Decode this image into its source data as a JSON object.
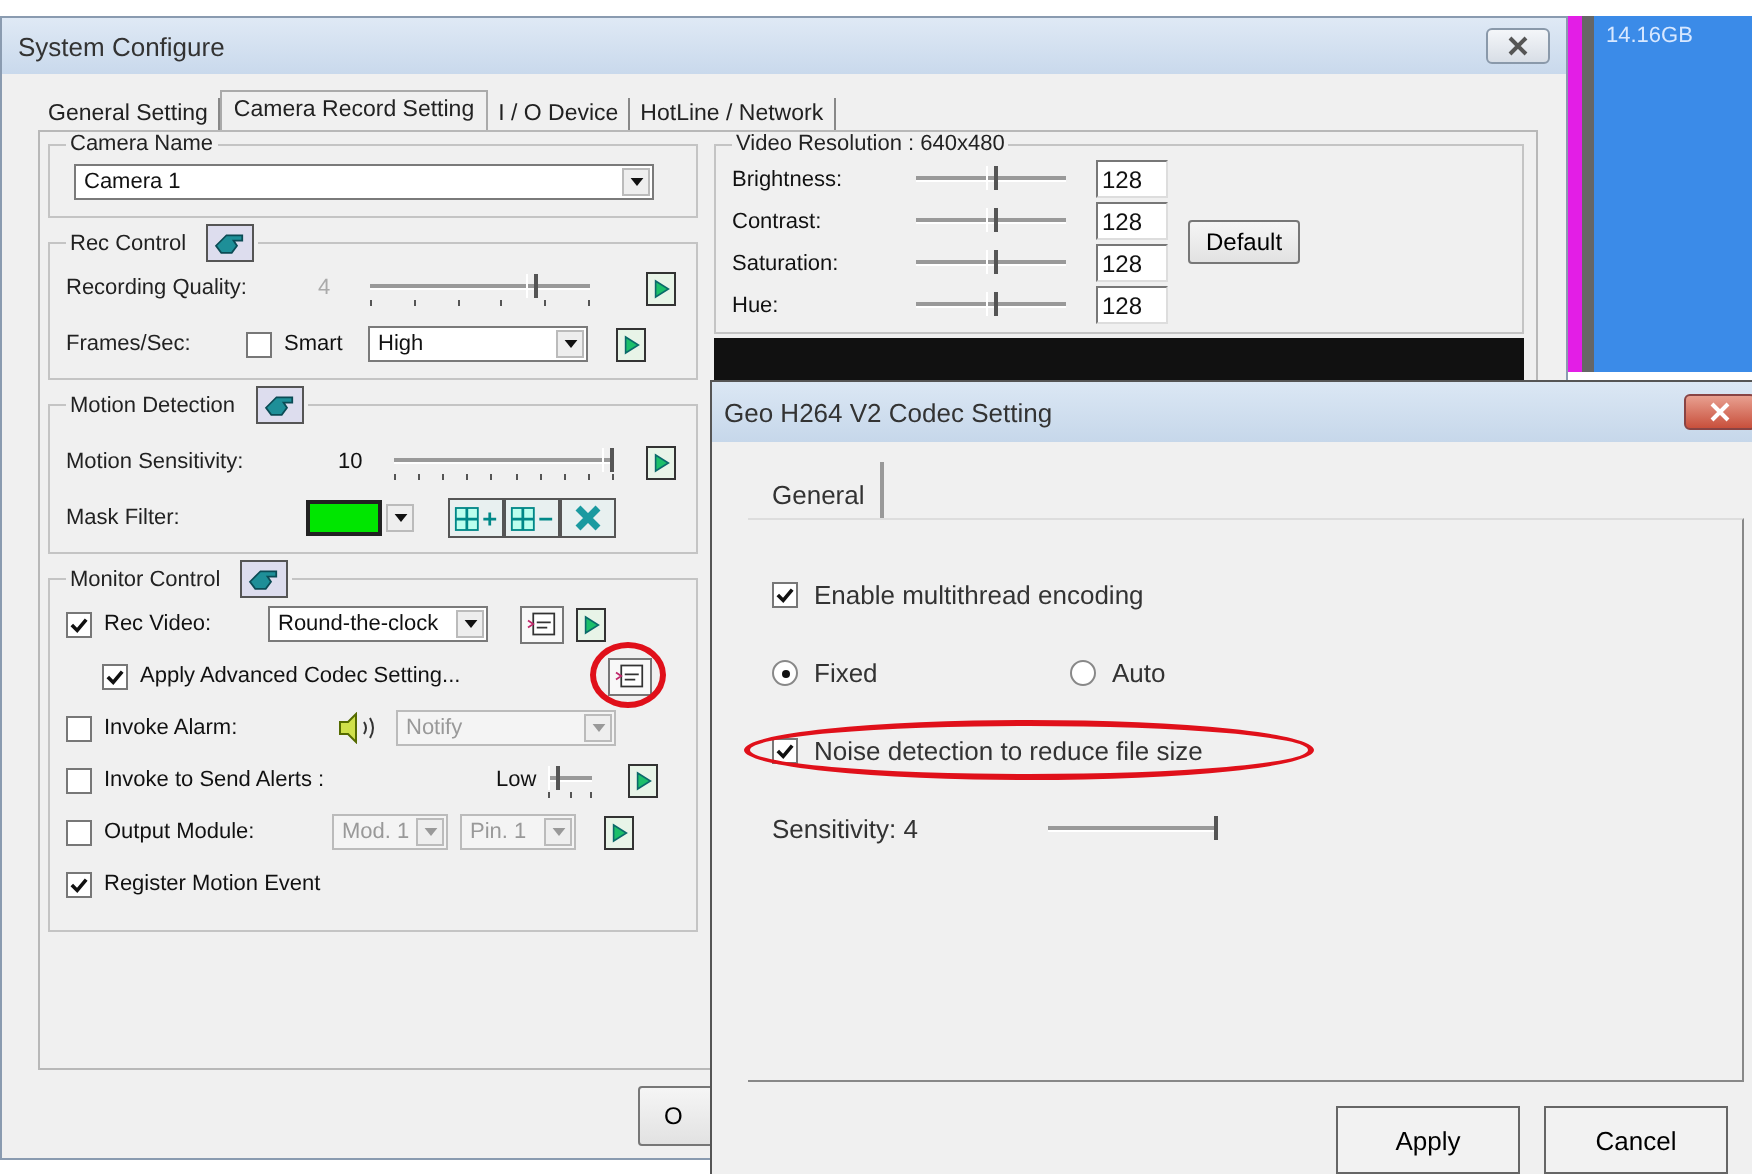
{
  "main_window": {
    "title": "System Configure"
  },
  "tabs": [
    {
      "label": "General Setting",
      "selected": false
    },
    {
      "label": "Camera Record Setting",
      "selected": true
    },
    {
      "label": "I / O Device",
      "selected": false
    },
    {
      "label": "HotLine / Network",
      "selected": false
    }
  ],
  "camera_name": {
    "legend": "Camera Name",
    "value": "Camera 1"
  },
  "rec_control": {
    "legend": "Rec Control",
    "quality_label": "Recording Quality:",
    "quality_value": "4",
    "quality_slider": {
      "level": 0.75
    },
    "fps_label": "Frames/Sec:",
    "smart": {
      "label": "Smart",
      "checked": false
    },
    "fps_value": "High"
  },
  "motion_detection": {
    "legend": "Motion Detection",
    "sensitivity_label": "Motion Sensitivity:",
    "sensitivity_value": "10",
    "sensitivity_slider": {
      "level": 1
    },
    "mask_label": "Mask Filter:"
  },
  "monitor_control": {
    "legend": "Monitor Control",
    "rows": [
      {
        "kind": "dropdown",
        "label": "Rec Video:",
        "checked": true,
        "value": "Round-the-clock",
        "disabled": false
      },
      {
        "kind": "codec",
        "label": "Apply Advanced Codec Setting...",
        "checked": true,
        "highlighted": true
      },
      {
        "kind": "alarm",
        "label": "Invoke Alarm:",
        "checked": false,
        "value": "Notify",
        "disabled": true
      },
      {
        "kind": "alerts",
        "label": "Invoke to Send Alerts :",
        "checked": false,
        "value": "Low",
        "level": 0
      },
      {
        "kind": "output",
        "label": "Output Module:",
        "checked": false,
        "values": [
          "Mod. 1",
          "Pin. 1"
        ],
        "disabled": true
      },
      {
        "kind": "plain",
        "label": "Register Motion Event",
        "checked": true
      }
    ]
  },
  "video_resolution": {
    "legend": "Video Resolution : 640x480",
    "sliders": [
      {
        "label": "Brightness:",
        "level": 0.5,
        "value": "128"
      },
      {
        "label": "Contrast:",
        "level": 0.5,
        "value": "128"
      },
      {
        "label": "Saturation:",
        "level": 0.5,
        "value": "128"
      },
      {
        "label": "Hue:",
        "level": 0.5,
        "value": "128"
      }
    ],
    "default_button": "Default"
  },
  "ok_button": "O",
  "disk": {
    "text": "14.16GB"
  },
  "codec_dialog": {
    "title": "Geo H264 V2 Codec Setting",
    "tabs": [
      {
        "label": "General",
        "selected": true
      }
    ],
    "multithread": {
      "label": "Enable multithread encoding",
      "checked": true
    },
    "modes": [
      {
        "label": "Fixed",
        "selected": true
      },
      {
        "label": "Auto",
        "selected": false
      }
    ],
    "noise": {
      "label": "Noise detection to reduce file size",
      "checked": true,
      "highlighted": true
    },
    "sensitivity": {
      "label": "Sensitivity: 4",
      "level": 1
    },
    "buttons": [
      "Apply",
      "Cancel"
    ]
  }
}
